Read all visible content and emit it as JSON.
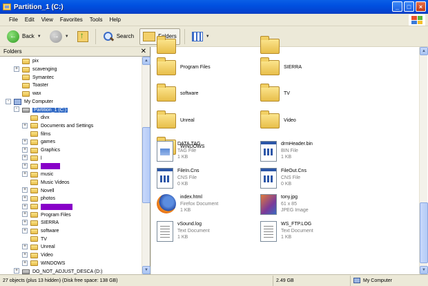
{
  "window": {
    "title": "Partition_1 (C:)"
  },
  "menu": [
    "File",
    "Edit",
    "View",
    "Favorites",
    "Tools",
    "Help"
  ],
  "toolbar": {
    "back_label": "Back",
    "search_label": "Search",
    "folders_label": "Folders"
  },
  "folders_pane": {
    "title": "Folders",
    "tree": [
      {
        "label": "pix",
        "expander": ""
      },
      {
        "label": "scavenging",
        "expander": "+"
      },
      {
        "label": "Symantec",
        "expander": ""
      },
      {
        "label": "Toaster",
        "expander": ""
      },
      {
        "label": "wax",
        "expander": ""
      },
      {
        "label": "My Computer",
        "expander": "-"
      },
      {
        "label": "Partition_1 (C:)",
        "expander": "-",
        "selected": true
      },
      {
        "label": "divx",
        "expander": ""
      },
      {
        "label": "Documents and Settings",
        "expander": "+"
      },
      {
        "label": "films",
        "expander": ""
      },
      {
        "label": "games",
        "expander": "+"
      },
      {
        "label": "Graphics",
        "expander": "+"
      },
      {
        "label": "l",
        "expander": "+"
      },
      {
        "label": "",
        "expander": "+",
        "redacted": "short"
      },
      {
        "label": "music",
        "expander": "+"
      },
      {
        "label": "Music Videos",
        "expander": ""
      },
      {
        "label": "Novell",
        "expander": "+"
      },
      {
        "label": "photos",
        "expander": "+"
      },
      {
        "label": "",
        "expander": "+",
        "redacted": "wide"
      },
      {
        "label": "Program Files",
        "expander": "+"
      },
      {
        "label": "SIERRA",
        "expander": "+"
      },
      {
        "label": "software",
        "expander": "+"
      },
      {
        "label": "TV",
        "expander": ""
      },
      {
        "label": "Unreal",
        "expander": "+"
      },
      {
        "label": "Video",
        "expander": "+"
      },
      {
        "label": "WINDOWS",
        "expander": "+"
      },
      {
        "label": "DO_NOT_ADJUST_DESCA (D:)",
        "expander": "+"
      }
    ]
  },
  "content": {
    "items": [
      {
        "name": "Program Files",
        "kind": "folder"
      },
      {
        "name": "SIERRA",
        "kind": "folder"
      },
      {
        "name": "software",
        "kind": "folder"
      },
      {
        "name": "TV",
        "kind": "folder"
      },
      {
        "name": "Unreal",
        "kind": "folder"
      },
      {
        "name": "Video",
        "kind": "folder"
      },
      {
        "name": "WINDOWS",
        "kind": "folder"
      },
      {
        "name": "DATA.TAG",
        "type": "TAG File",
        "size": "1 KB",
        "kind": "tag"
      },
      {
        "name": "drmHeader.bin",
        "type": "BIN File",
        "size": "1 KB",
        "kind": "bin"
      },
      {
        "name": "FileIn.Cns",
        "type": "CNS File",
        "size": "0 KB",
        "kind": "bin"
      },
      {
        "name": "FileOut.Cns",
        "type": "CNS File",
        "size": "0 KB",
        "kind": "bin"
      },
      {
        "name": "index.html",
        "type": "Firefox Document",
        "size": "1 KB",
        "kind": "firefox"
      },
      {
        "name": "tony.jpg",
        "type": "61 x 85",
        "size": "JPEG Image",
        "kind": "jpg"
      },
      {
        "name": "vSound.log",
        "type": "Text Document",
        "size": "1 KB",
        "kind": "txt"
      },
      {
        "name": "WS_FTP.LOG",
        "type": "Text Document",
        "size": "1 KB",
        "kind": "txt"
      }
    ]
  },
  "statusbar": {
    "objects": "27 objects (plus 13 hidden) (Disk free space: 138 GB)",
    "size": "2.49 GB",
    "location": "My Computer"
  }
}
